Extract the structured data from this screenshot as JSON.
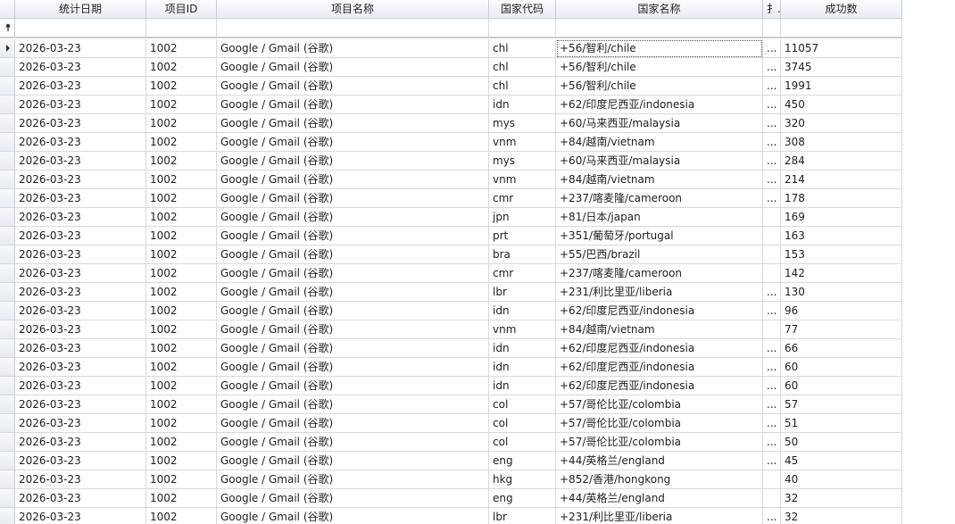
{
  "columns": [
    {
      "key": "date",
      "label": "统计日期"
    },
    {
      "key": "pid",
      "label": "项目ID"
    },
    {
      "key": "pname",
      "label": "项目名称"
    },
    {
      "key": "ccode",
      "label": "国家代码"
    },
    {
      "key": "cname",
      "label": "国家名称"
    },
    {
      "key": "extra",
      "label": "扌.."
    },
    {
      "key": "success",
      "label": "成功数"
    }
  ],
  "rows": [
    {
      "date": "2026-03-23",
      "pid": "1002",
      "pname": "Google / Gmail (谷歌)",
      "ccode": "chl",
      "cname": "+56/智利/chile",
      "extra": "...",
      "success": "11057"
    },
    {
      "date": "2026-03-23",
      "pid": "1002",
      "pname": "Google / Gmail (谷歌)",
      "ccode": "chl",
      "cname": "+56/智利/chile",
      "extra": "...",
      "success": "3745"
    },
    {
      "date": "2026-03-23",
      "pid": "1002",
      "pname": "Google / Gmail (谷歌)",
      "ccode": "chl",
      "cname": "+56/智利/chile",
      "extra": "...",
      "success": "1991"
    },
    {
      "date": "2026-03-23",
      "pid": "1002",
      "pname": "Google / Gmail (谷歌)",
      "ccode": "idn",
      "cname": "+62/印度尼西亚/indonesia",
      "extra": "...",
      "success": "450"
    },
    {
      "date": "2026-03-23",
      "pid": "1002",
      "pname": "Google / Gmail (谷歌)",
      "ccode": "mys",
      "cname": "+60/马来西亚/malaysia",
      "extra": "...",
      "success": "320"
    },
    {
      "date": "2026-03-23",
      "pid": "1002",
      "pname": "Google / Gmail (谷歌)",
      "ccode": "vnm",
      "cname": "+84/越南/vietnam",
      "extra": "...",
      "success": "308"
    },
    {
      "date": "2026-03-23",
      "pid": "1002",
      "pname": "Google / Gmail (谷歌)",
      "ccode": "mys",
      "cname": "+60/马来西亚/malaysia",
      "extra": "...",
      "success": "284"
    },
    {
      "date": "2026-03-23",
      "pid": "1002",
      "pname": "Google / Gmail (谷歌)",
      "ccode": "vnm",
      "cname": "+84/越南/vietnam",
      "extra": "...",
      "success": "214"
    },
    {
      "date": "2026-03-23",
      "pid": "1002",
      "pname": "Google / Gmail (谷歌)",
      "ccode": "cmr",
      "cname": "+237/喀麦隆/cameroon",
      "extra": "...",
      "success": "178"
    },
    {
      "date": "2026-03-23",
      "pid": "1002",
      "pname": "Google / Gmail (谷歌)",
      "ccode": "jpn",
      "cname": "+81/日本/japan",
      "extra": "",
      "success": "169"
    },
    {
      "date": "2026-03-23",
      "pid": "1002",
      "pname": "Google / Gmail (谷歌)",
      "ccode": "prt",
      "cname": "+351/葡萄牙/portugal",
      "extra": "",
      "success": "163"
    },
    {
      "date": "2026-03-23",
      "pid": "1002",
      "pname": "Google / Gmail (谷歌)",
      "ccode": "bra",
      "cname": "+55/巴西/brazil",
      "extra": "",
      "success": "153"
    },
    {
      "date": "2026-03-23",
      "pid": "1002",
      "pname": "Google / Gmail (谷歌)",
      "ccode": "cmr",
      "cname": "+237/喀麦隆/cameroon",
      "extra": "",
      "success": "142"
    },
    {
      "date": "2026-03-23",
      "pid": "1002",
      "pname": "Google / Gmail (谷歌)",
      "ccode": "lbr",
      "cname": "+231/利比里亚/liberia",
      "extra": "...",
      "success": "130"
    },
    {
      "date": "2026-03-23",
      "pid": "1002",
      "pname": "Google / Gmail (谷歌)",
      "ccode": "idn",
      "cname": "+62/印度尼西亚/indonesia",
      "extra": "...",
      "success": "96"
    },
    {
      "date": "2026-03-23",
      "pid": "1002",
      "pname": "Google / Gmail (谷歌)",
      "ccode": "vnm",
      "cname": "+84/越南/vietnam",
      "extra": "",
      "success": "77"
    },
    {
      "date": "2026-03-23",
      "pid": "1002",
      "pname": "Google / Gmail (谷歌)",
      "ccode": "idn",
      "cname": "+62/印度尼西亚/indonesia",
      "extra": "...",
      "success": "66"
    },
    {
      "date": "2026-03-23",
      "pid": "1002",
      "pname": "Google / Gmail (谷歌)",
      "ccode": "idn",
      "cname": "+62/印度尼西亚/indonesia",
      "extra": "...",
      "success": "60"
    },
    {
      "date": "2026-03-23",
      "pid": "1002",
      "pname": "Google / Gmail (谷歌)",
      "ccode": "idn",
      "cname": "+62/印度尼西亚/indonesia",
      "extra": "...",
      "success": "60"
    },
    {
      "date": "2026-03-23",
      "pid": "1002",
      "pname": "Google / Gmail (谷歌)",
      "ccode": "col",
      "cname": "+57/哥伦比亚/colombia",
      "extra": "...",
      "success": "57"
    },
    {
      "date": "2026-03-23",
      "pid": "1002",
      "pname": "Google / Gmail (谷歌)",
      "ccode": "col",
      "cname": "+57/哥伦比亚/colombia",
      "extra": "...",
      "success": "51"
    },
    {
      "date": "2026-03-23",
      "pid": "1002",
      "pname": "Google / Gmail (谷歌)",
      "ccode": "col",
      "cname": "+57/哥伦比亚/colombia",
      "extra": "...",
      "success": "50"
    },
    {
      "date": "2026-03-23",
      "pid": "1002",
      "pname": "Google / Gmail (谷歌)",
      "ccode": "eng",
      "cname": "+44/英格兰/england",
      "extra": "...",
      "success": "45"
    },
    {
      "date": "2026-03-23",
      "pid": "1002",
      "pname": "Google / Gmail (谷歌)",
      "ccode": "hkg",
      "cname": "+852/香港/hongkong",
      "extra": "",
      "success": "40"
    },
    {
      "date": "2026-03-23",
      "pid": "1002",
      "pname": "Google / Gmail (谷歌)",
      "ccode": "eng",
      "cname": "+44/英格兰/england",
      "extra": "",
      "success": "32"
    },
    {
      "date": "2026-03-23",
      "pid": "1002",
      "pname": "Google / Gmail (谷歌)",
      "ccode": "lbr",
      "cname": "+231/利比里亚/liberia",
      "extra": "...",
      "success": "32"
    }
  ],
  "icons": {
    "current_row": "row-indicator-arrow-icon",
    "filter_row": "filter-pin-icon"
  },
  "colors": {
    "grid_line": "#d4dae3",
    "header_bg": "#e9edf2",
    "focus_outline": "#555555"
  }
}
